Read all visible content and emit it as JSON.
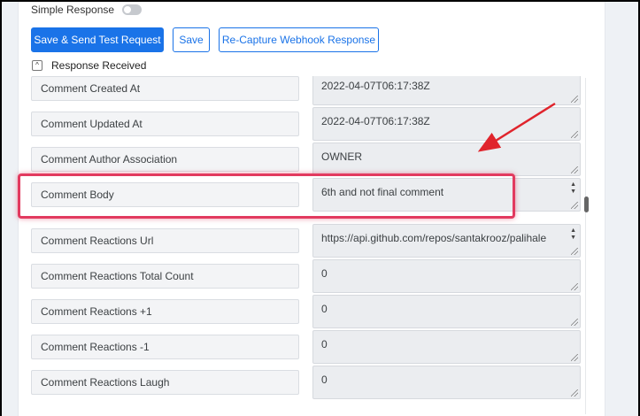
{
  "toggle": {
    "label": "Simple Response",
    "checked": false
  },
  "buttons": {
    "save_send": "Save & Send Test Request",
    "save": "Save",
    "recapture": "Re-Capture Webhook Response"
  },
  "response_section": {
    "label": "Response Received",
    "chevron": "^"
  },
  "fields": [
    {
      "label": "Comment Created At",
      "value": "2022-04-07T06:17:38Z"
    },
    {
      "label": "Comment Updated At",
      "value": "2022-04-07T06:17:38Z"
    },
    {
      "label": "Comment Author Association",
      "value": "OWNER"
    },
    {
      "label": "Comment Body",
      "value": "6th and not final comment"
    },
    {
      "label": "Comment Reactions Url",
      "value": "https://api.github.com/repos/santakrooz/palihale"
    },
    {
      "label": "Comment Reactions Total Count",
      "value": "0"
    },
    {
      "label": "Comment Reactions +1",
      "value": "0"
    },
    {
      "label": "Comment Reactions -1",
      "value": "0"
    },
    {
      "label": "Comment Reactions Laugh",
      "value": "0"
    }
  ],
  "colors": {
    "primary": "#1a73e8",
    "highlight": "#e23a5f",
    "arrow": "#e0242c"
  },
  "spinner": {
    "up": "▲",
    "down": "▼"
  }
}
